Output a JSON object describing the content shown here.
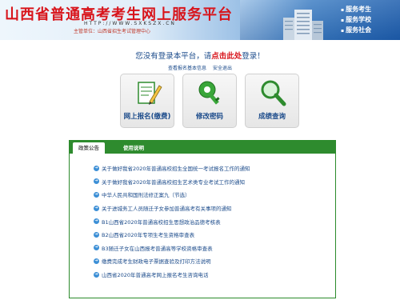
{
  "header": {
    "title": "山西省普通高考考生网上服务平台",
    "url": "HTTP://WWW.SXKSZX.CN",
    "sponsor": "主管单位：山西省招生考试管理中心",
    "services": [
      "服务考生",
      "服务学校",
      "服务社会"
    ]
  },
  "login_prompt": {
    "text_before": "您没有登录本平台，请",
    "link": "点击此处",
    "text_after": "登录！"
  },
  "sub_links": [
    "查看报名基本信息",
    "安全退出"
  ],
  "tiles": [
    {
      "label": "网上报名(缴费)",
      "icon": "form-pencil-icon"
    },
    {
      "label": "修改密码",
      "icon": "key-icon"
    },
    {
      "label": "成绩查询",
      "icon": "magnifier-icon"
    }
  ],
  "tabs": [
    "政策公告",
    "使用说明"
  ],
  "news": [
    "关于做好我省2020年普通高校招生全国统一考试报名工作的通知",
    "关于做好我省2020年普通高校招生艺术类专业考试工作的通知",
    "中华人民共和国刑法修正案九（节选）",
    "关于进城务工人员随迁子女参加普通高考有关事项的通知",
    "B1山西省2020年普通高校招生思想政治品德考核表",
    "B2山西省2020年专项生考生资格审查表",
    "B3随迁子女在山西报考普通高等学校资格审查表",
    "缴费完成考生财政电子票据查验及打印方法说明",
    "山西省2020年普通高考网上报名考生咨询电话"
  ],
  "colors": {
    "title_red": "#d8141b",
    "link_blue": "#1a4a8a",
    "tab_green": "#2e8b2e"
  }
}
